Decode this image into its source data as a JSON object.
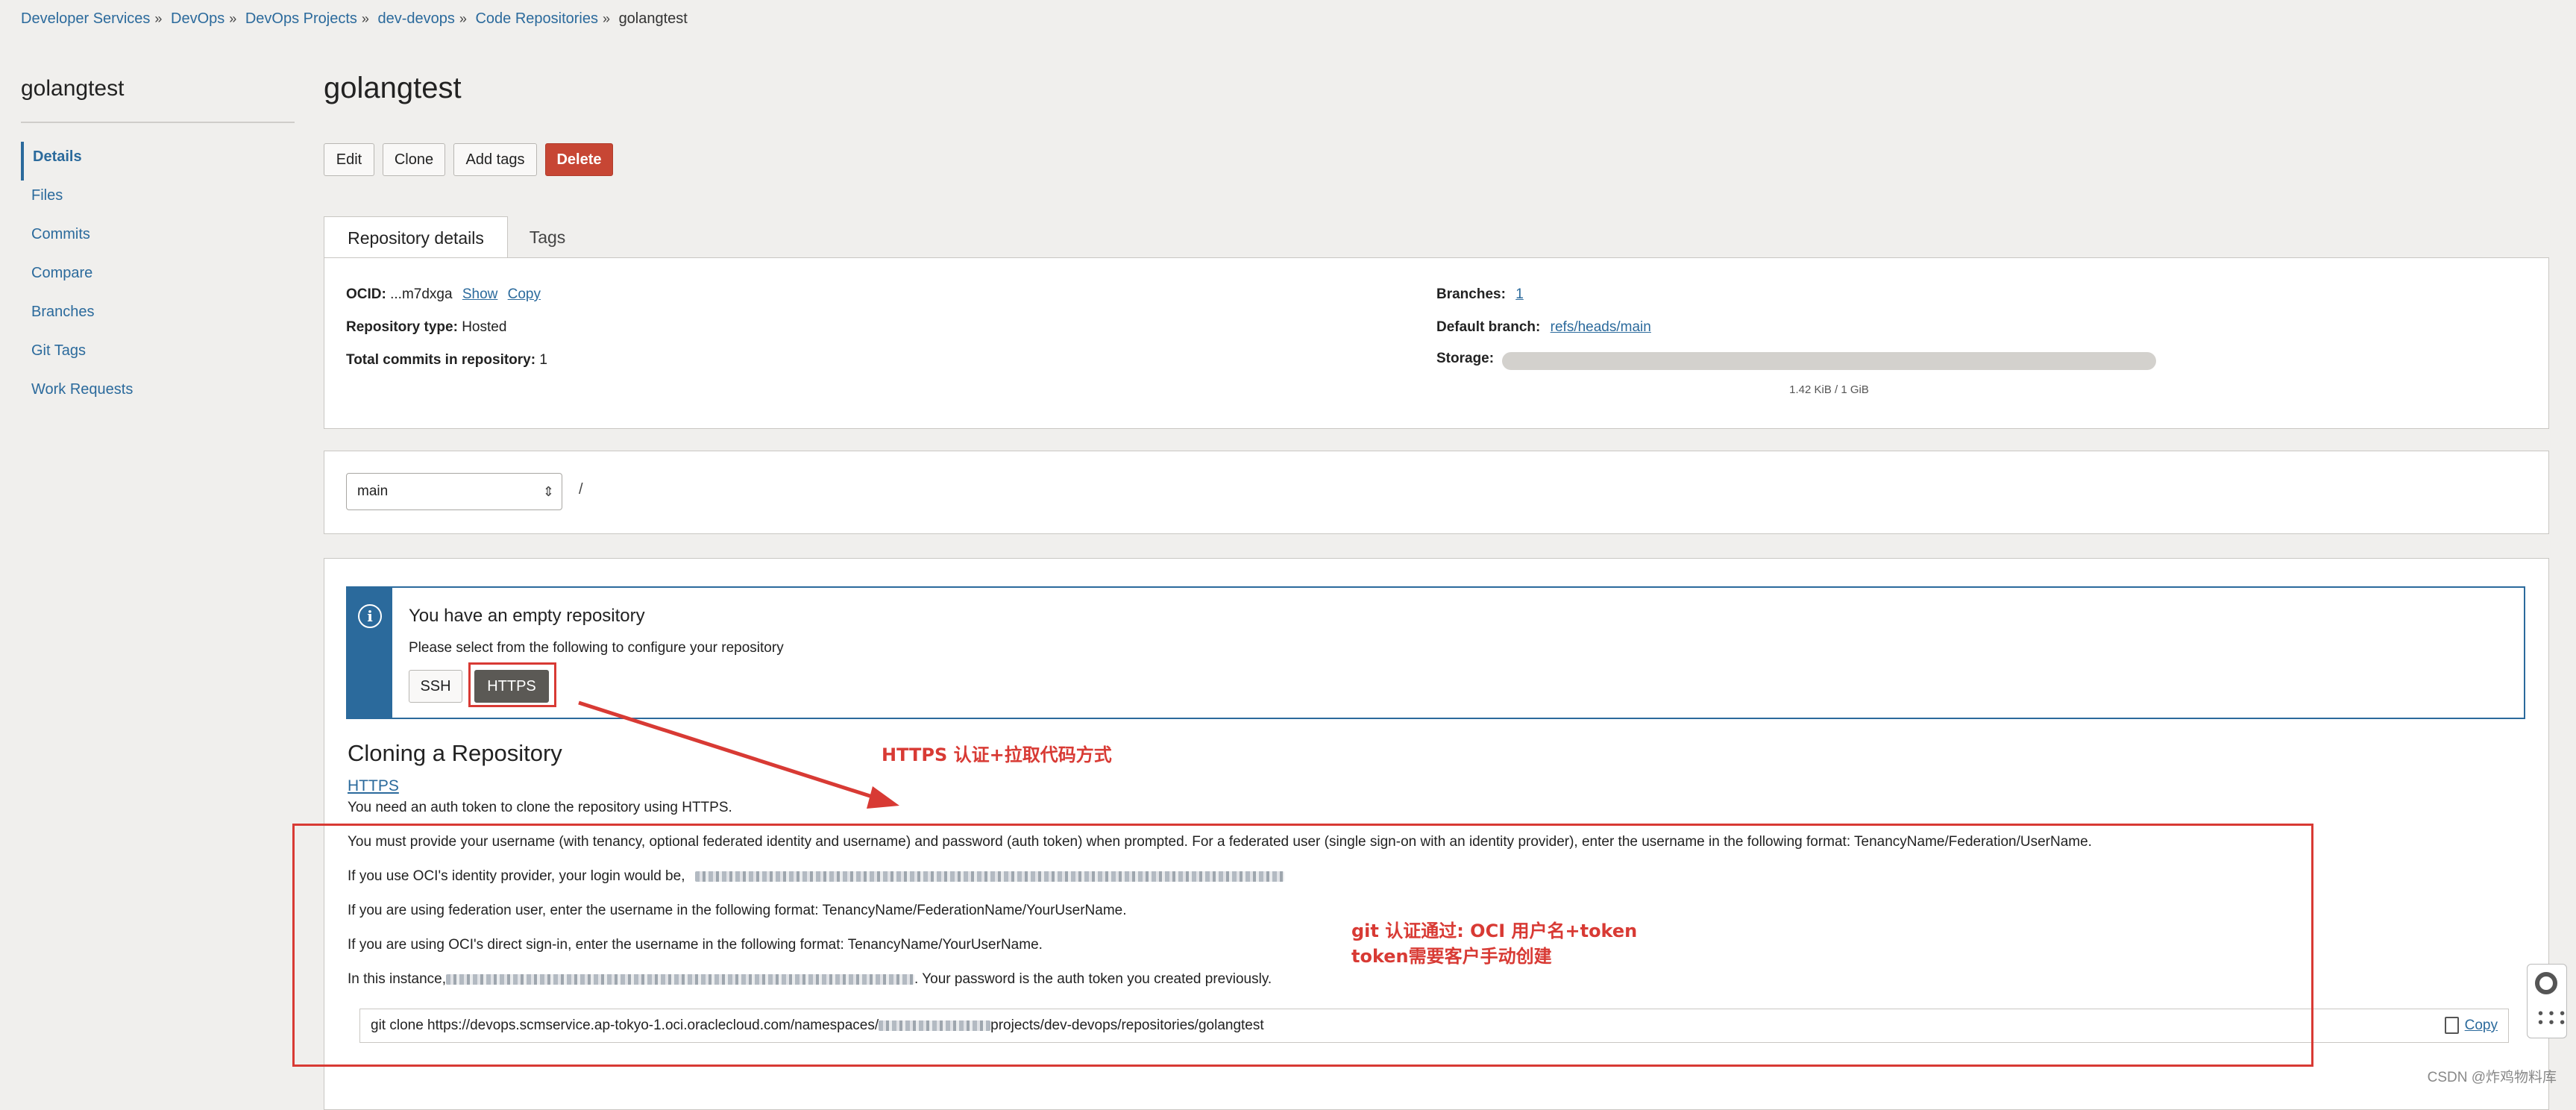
{
  "breadcrumb": [
    "Developer Services",
    "DevOps",
    "DevOps Projects",
    "dev-devops",
    "Code Repositories",
    "golangtest"
  ],
  "sidebar": {
    "title": "golangtest",
    "items": [
      {
        "label": "Details",
        "active": true
      },
      {
        "label": "Files"
      },
      {
        "label": "Commits"
      },
      {
        "label": "Compare"
      },
      {
        "label": "Branches"
      },
      {
        "label": "Git Tags"
      },
      {
        "label": "Work Requests"
      }
    ]
  },
  "page": {
    "title": "golangtest"
  },
  "actions": {
    "edit": "Edit",
    "clone": "Clone",
    "add_tags": "Add tags",
    "delete": "Delete"
  },
  "tabs": {
    "details": "Repository details",
    "tags": "Tags"
  },
  "details": {
    "ocid_label": "OCID:",
    "ocid_value": "...m7dxga",
    "show": "Show",
    "copy": "Copy",
    "repo_type_label": "Repository type:",
    "repo_type_value": "Hosted",
    "commits_label": "Total commits in repository:",
    "commits_value": "1",
    "branches_label": "Branches:",
    "branches_value": "1",
    "default_branch_label": "Default branch:",
    "default_branch_value": "refs/heads/main",
    "storage_label": "Storage:",
    "storage_text": "1.42 KiB / 1 GiB",
    "storage_fraction": 1.3e-06
  },
  "branch_select": {
    "value": "main",
    "path": "/"
  },
  "notice": {
    "title": "You have an empty repository",
    "subtitle": "Please select from the following to configure your repository",
    "ssh": "SSH",
    "https": "HTTPS"
  },
  "cloning": {
    "heading": "Cloning a Repository",
    "protocol": "HTTPS",
    "lines": {
      "l1": "You need an auth token to clone the repository using HTTPS.",
      "l2": "You must provide your username (with tenancy, optional federated identity and username) and password (auth token) when prompted. For a federated user (single sign-on with an identity provider), enter the username in the following format: TenancyName/Federation/UserName.",
      "l3": "If you use OCI's identity provider, your login would be,",
      "l4": "If you are using federation user, enter the username in the following format: TenancyName/FederationName/YourUserName.",
      "l5": "If you are using OCI's direct sign-in, enter the username in the following format: TenancyName/YourUserName.",
      "l6a": "In this instance,",
      "l6b": ". Your password is the auth token you created previously."
    },
    "command_a": "git clone https://devops.scmservice.ap-tokyo-1.oci.oraclecloud.com/namespaces/",
    "command_b": "projects/dev-devops/repositories/golangtest",
    "copy": "Copy"
  },
  "annotations": {
    "a1": "HTTPS 认证+拉取代码方式",
    "a2": "git 认证通过: OCI 用户名+token",
    "a3": "token需要客户手动创建"
  },
  "colors": {
    "accent": "#2b6a9c",
    "danger": "#c74634",
    "annotation": "#d83a34"
  },
  "watermark": "CSDN @炸鸡物料库"
}
